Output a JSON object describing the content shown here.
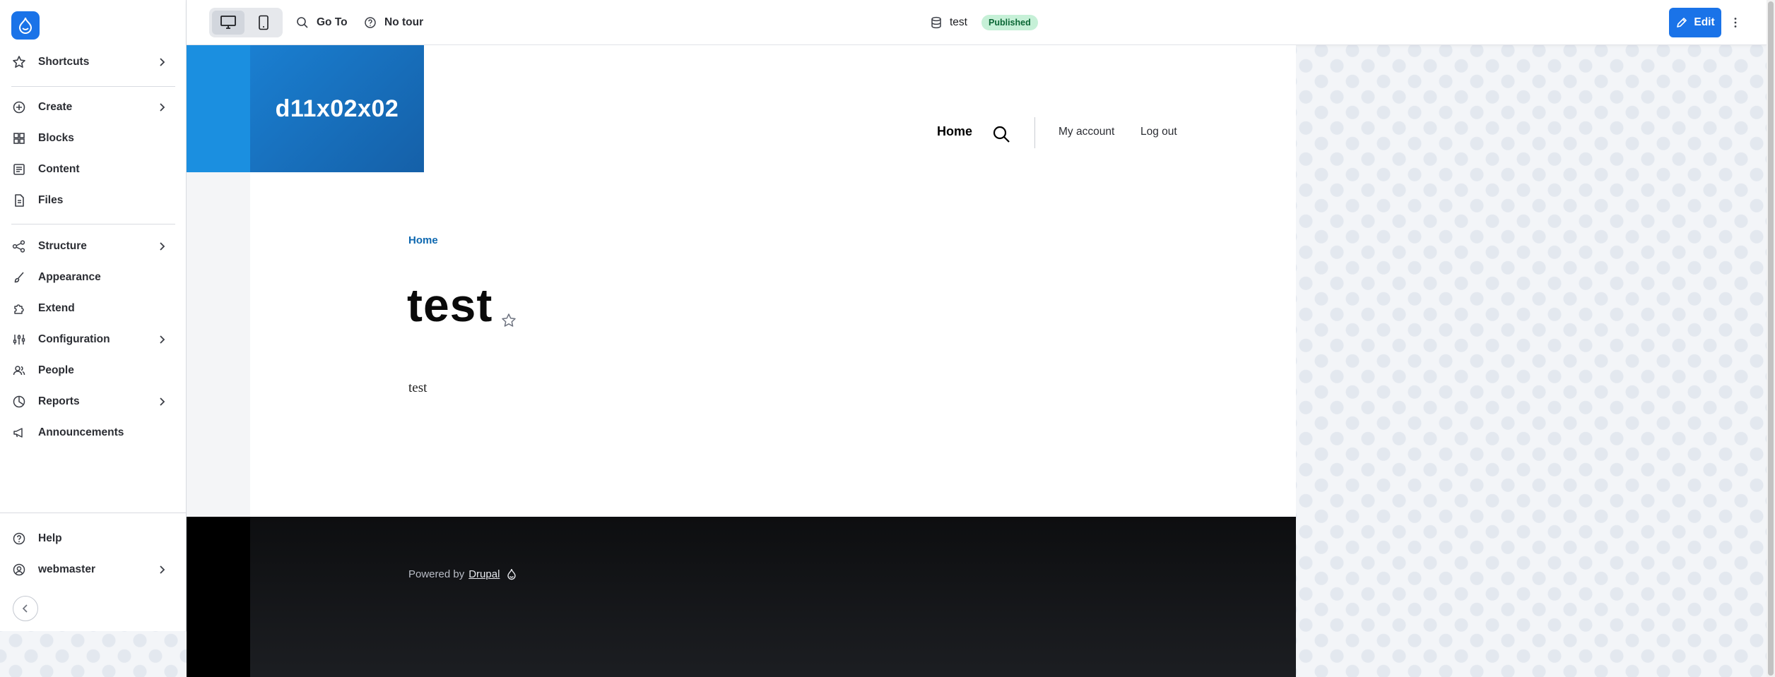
{
  "sidebar": {
    "items": [
      {
        "label": "Shortcuts",
        "icon": "star-icon",
        "has_submenu": true
      },
      {
        "label": "Create",
        "icon": "plus-circle-icon",
        "has_submenu": true
      },
      {
        "label": "Blocks",
        "icon": "blocks-icon",
        "has_submenu": false
      },
      {
        "label": "Content",
        "icon": "content-icon",
        "has_submenu": false
      },
      {
        "label": "Files",
        "icon": "file-icon",
        "has_submenu": false
      },
      {
        "label": "Structure",
        "icon": "structure-icon",
        "has_submenu": true
      },
      {
        "label": "Appearance",
        "icon": "brush-icon",
        "has_submenu": false
      },
      {
        "label": "Extend",
        "icon": "puzzle-icon",
        "has_submenu": false
      },
      {
        "label": "Configuration",
        "icon": "sliders-icon",
        "has_submenu": true
      },
      {
        "label": "People",
        "icon": "people-icon",
        "has_submenu": false
      },
      {
        "label": "Reports",
        "icon": "chart-icon",
        "has_submenu": true
      },
      {
        "label": "Announcements",
        "icon": "megaphone-icon",
        "has_submenu": false
      }
    ],
    "footer_items": [
      {
        "label": "Help",
        "icon": "help-icon",
        "has_submenu": false
      },
      {
        "label": "webmaster",
        "icon": "user-icon",
        "has_submenu": true
      }
    ]
  },
  "toolbar": {
    "goto_label": "Go To",
    "tour_label": "No tour",
    "page_title": "test",
    "status_badge": "Published",
    "edit_label": "Edit"
  },
  "site": {
    "name": "d11x02x02",
    "nav": {
      "home": "Home",
      "my_account": "My account",
      "log_out": "Log out"
    },
    "breadcrumb": "Home",
    "title": "test",
    "body": "test",
    "footer": {
      "powered_by": "Powered by",
      "link": "Drupal"
    }
  },
  "colors": {
    "accent": "#1a73e8",
    "badge_bg": "#c6f0d7",
    "badge_text": "#0a6634",
    "branding": "#1560a8"
  }
}
